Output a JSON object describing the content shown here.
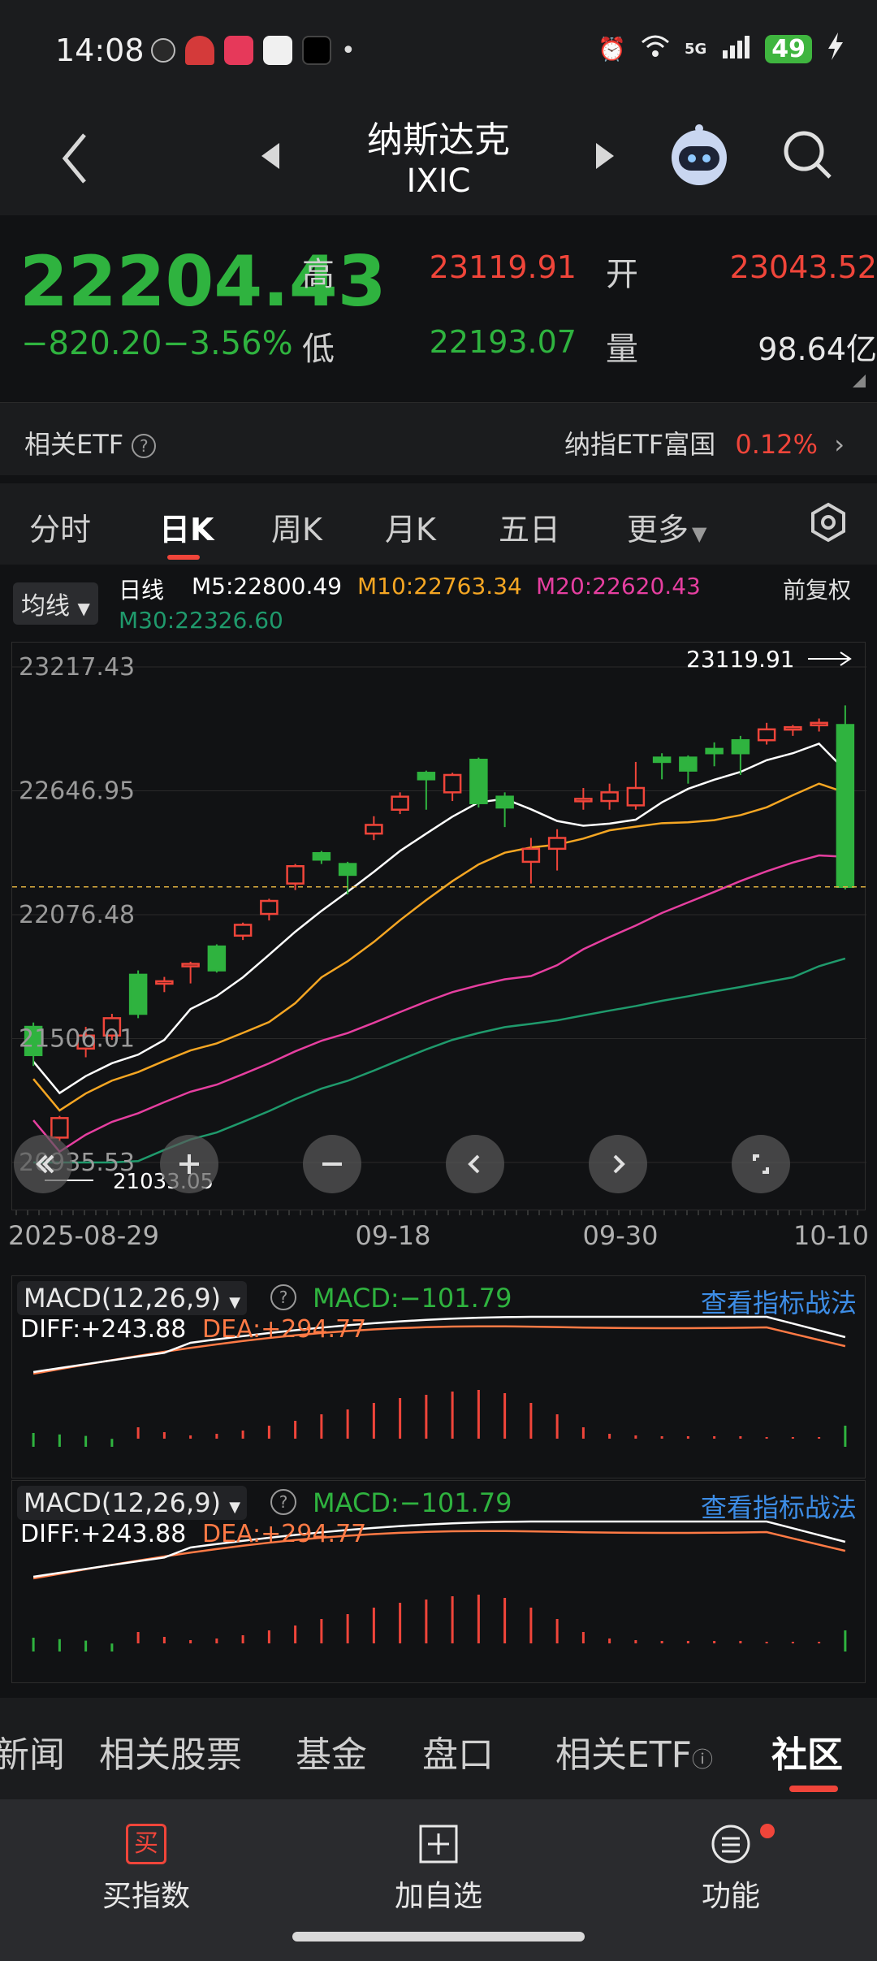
{
  "status": {
    "time": "14:08",
    "network": "5G",
    "battery": "49"
  },
  "header": {
    "title": "纳斯达克",
    "code": "IXIC"
  },
  "quote": {
    "price": "22204.43",
    "change": "−820.20",
    "change_pct": "−3.56%",
    "high_label": "高",
    "high": "23119.91",
    "low_label": "低",
    "low": "22193.07",
    "open_label": "开",
    "open": "23043.52",
    "volume_label": "量",
    "volume": "98.64亿"
  },
  "etf": {
    "label": "相关ETF",
    "name": "纳指ETF富国",
    "pct": "0.12%"
  },
  "tabs": [
    "分时",
    "日K",
    "周K",
    "月K",
    "五日",
    "更多"
  ],
  "ma": {
    "selector": "均线",
    "period": "日线",
    "m5": "M5:22800.49",
    "m10": "M10:22763.34",
    "m20": "M20:22620.43",
    "m30": "M30:22326.60",
    "adjust": "前复权"
  },
  "chart": {
    "y_labels": [
      "23217.43",
      "22646.95",
      "22076.48",
      "21506.01",
      "20935.53"
    ],
    "high_tag": "23119.91",
    "low_tag": "21033.05",
    "x_labels": [
      "2025-08-29",
      "09-18",
      "09-30",
      "10-10"
    ]
  },
  "macd": {
    "name": "MACD(12,26,9)",
    "macd": "MACD:−101.79",
    "diff": "DIFF:+243.88",
    "dea": "DEA:+294.77",
    "link": "查看指标战法"
  },
  "bottom_tabs": [
    "新闻",
    "相关股票",
    "基金",
    "盘口",
    "相关ETF",
    "社区"
  ],
  "actions": {
    "buy": "买指数",
    "add": "加自选",
    "func": "功能",
    "buy_icon": "买"
  },
  "colors": {
    "up": "#f0453a",
    "down": "#2fb33f",
    "m5": "#ffffff",
    "m10": "#f5a623",
    "m20": "#e63fa0",
    "m30": "#1f9a6c"
  },
  "chart_data": {
    "type": "candlestick",
    "categories": [
      "2025-08-29",
      "09-18",
      "09-30",
      "10-10"
    ],
    "ylim": [
      20935.53,
      23217.43
    ],
    "candles": [
      {
        "o": 21560,
        "c": 21430,
        "h": 21580,
        "l": 21380
      },
      {
        "o": 21050,
        "c": 21140,
        "h": 21150,
        "l": 21033
      },
      {
        "o": 21460,
        "c": 21520,
        "h": 21560,
        "l": 21420
      },
      {
        "o": 21520,
        "c": 21600,
        "h": 21620,
        "l": 21500
      },
      {
        "o": 21800,
        "c": 21620,
        "h": 21820,
        "l": 21600
      },
      {
        "o": 21770,
        "c": 21770,
        "h": 21790,
        "l": 21720
      },
      {
        "o": 21840,
        "c": 21850,
        "h": 21860,
        "l": 21760
      },
      {
        "o": 21930,
        "c": 21820,
        "h": 21940,
        "l": 21810
      },
      {
        "o": 21980,
        "c": 22030,
        "h": 22040,
        "l": 21960
      },
      {
        "o": 22080,
        "c": 22140,
        "h": 22150,
        "l": 22050
      },
      {
        "o": 22220,
        "c": 22300,
        "h": 22310,
        "l": 22190
      },
      {
        "o": 22360,
        "c": 22330,
        "h": 22370,
        "l": 22310
      },
      {
        "o": 22310,
        "c": 22260,
        "h": 22320,
        "l": 22170
      },
      {
        "o": 22450,
        "c": 22490,
        "h": 22530,
        "l": 22420
      },
      {
        "o": 22560,
        "c": 22620,
        "h": 22640,
        "l": 22540
      },
      {
        "o": 22730,
        "c": 22700,
        "h": 22740,
        "l": 22560
      },
      {
        "o": 22640,
        "c": 22720,
        "h": 22730,
        "l": 22600
      },
      {
        "o": 22790,
        "c": 22590,
        "h": 22800,
        "l": 22570
      },
      {
        "o": 22620,
        "c": 22570,
        "h": 22640,
        "l": 22480
      },
      {
        "o": 22320,
        "c": 22380,
        "h": 22430,
        "l": 22220
      },
      {
        "o": 22380,
        "c": 22430,
        "h": 22470,
        "l": 22280
      },
      {
        "o": 22600,
        "c": 22610,
        "h": 22660,
        "l": 22560
      },
      {
        "o": 22600,
        "c": 22640,
        "h": 22680,
        "l": 22560
      },
      {
        "o": 22580,
        "c": 22660,
        "h": 22780,
        "l": 22560
      },
      {
        "o": 22800,
        "c": 22780,
        "h": 22820,
        "l": 22700
      },
      {
        "o": 22800,
        "c": 22740,
        "h": 22810,
        "l": 22680
      },
      {
        "o": 22840,
        "c": 22820,
        "h": 22870,
        "l": 22760
      },
      {
        "o": 22880,
        "c": 22820,
        "h": 22900,
        "l": 22720
      },
      {
        "o": 22880,
        "c": 22930,
        "h": 22960,
        "l": 22860
      },
      {
        "o": 22940,
        "c": 22940,
        "h": 22950,
        "l": 22900
      },
      {
        "o": 22960,
        "c": 22960,
        "h": 22980,
        "l": 22920
      },
      {
        "o": 22950,
        "c": 22204.43,
        "h": 23040,
        "l": 22193.07
      }
    ]
  }
}
